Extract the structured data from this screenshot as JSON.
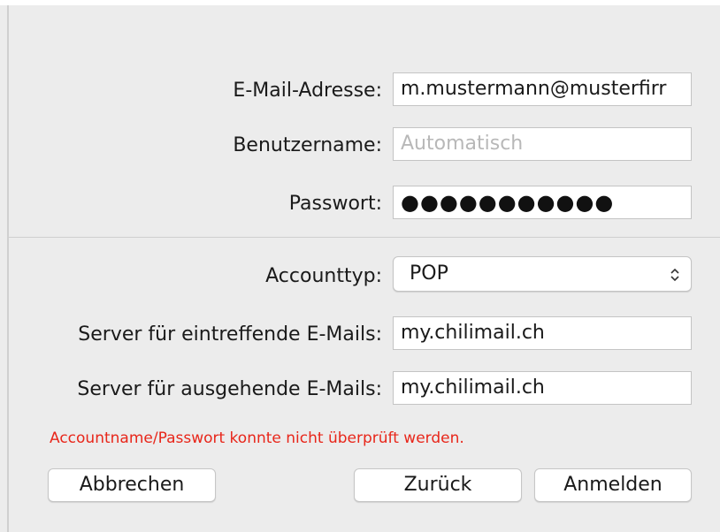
{
  "form": {
    "email_label": "E-Mail-Adresse:",
    "email_value": "m.mustermann@musterfirr",
    "username_label": "Benutzername:",
    "username_placeholder": "Automatisch",
    "password_label": "Passwort:",
    "password_masked": "●●●●●●●●●●●",
    "account_type_label": "Accounttyp:",
    "account_type_value": "POP",
    "incoming_label": "Server für eintreffende E-Mails:",
    "incoming_value": "my.chilimail.ch",
    "outgoing_label": "Server für ausgehende E-Mails:",
    "outgoing_value": "my.chilimail.ch"
  },
  "error_message": "Accountname/Passwort konnte nicht überprüft werden.",
  "buttons": {
    "cancel": "Abbrechen",
    "back": "Zurück",
    "sign_in": "Anmelden"
  },
  "colors": {
    "background": "#ececec",
    "error": "#e8261a"
  },
  "icons": {
    "select_chevron": "chevron-up-down-icon"
  }
}
